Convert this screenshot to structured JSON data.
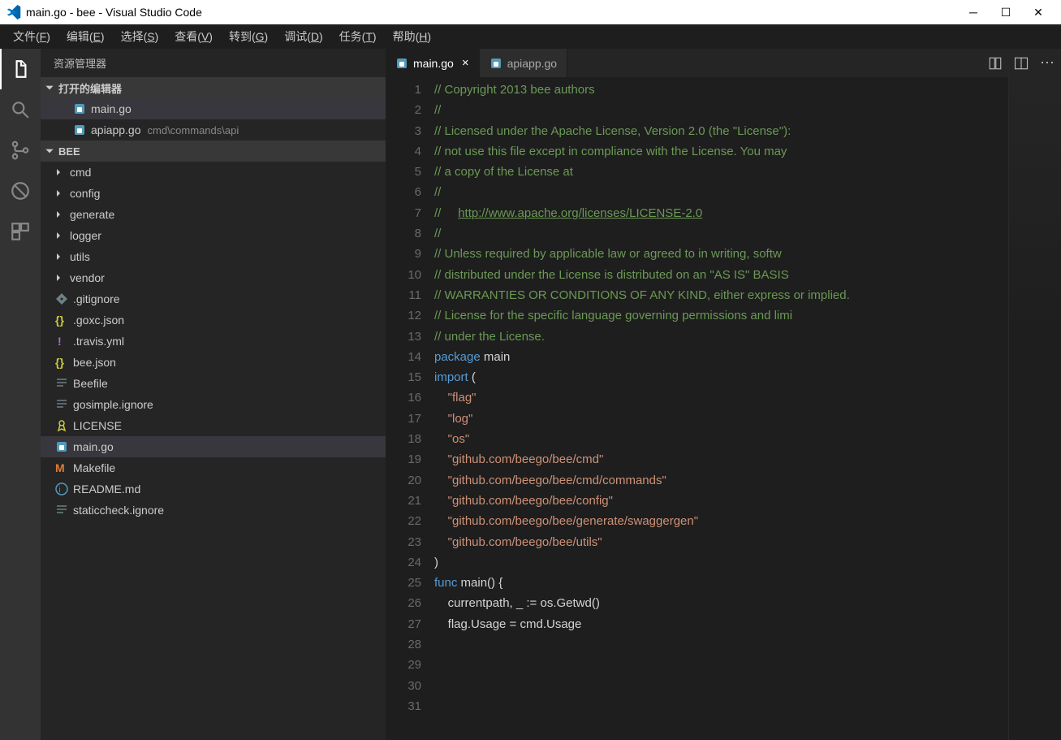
{
  "title": "main.go - bee - Visual Studio Code",
  "menubar": [
    "文件(F)",
    "编辑(E)",
    "选择(S)",
    "查看(V)",
    "转到(G)",
    "调试(D)",
    "任务(T)",
    "帮助(H)"
  ],
  "sidebar": {
    "title": "资源管理器",
    "openEditors": {
      "label": "打开的编辑器",
      "items": [
        {
          "name": "main.go",
          "path": "",
          "active": true,
          "icon": "go"
        },
        {
          "name": "apiapp.go",
          "path": "cmd\\commands\\api",
          "active": false,
          "icon": "go"
        }
      ]
    },
    "project": {
      "name": "BEE",
      "folders": [
        "cmd",
        "config",
        "generate",
        "logger",
        "utils",
        "vendor"
      ],
      "files": [
        {
          "name": ".gitignore",
          "icon": "git"
        },
        {
          "name": ".goxc.json",
          "icon": "json"
        },
        {
          "name": ".travis.yml",
          "icon": "yml"
        },
        {
          "name": "bee.json",
          "icon": "json"
        },
        {
          "name": "Beefile",
          "icon": "text"
        },
        {
          "name": "gosimple.ignore",
          "icon": "text"
        },
        {
          "name": "LICENSE",
          "icon": "license"
        },
        {
          "name": "main.go",
          "icon": "go",
          "active": true
        },
        {
          "name": "Makefile",
          "icon": "make"
        },
        {
          "name": "README.md",
          "icon": "md"
        },
        {
          "name": "staticcheck.ignore",
          "icon": "text"
        }
      ]
    }
  },
  "tabs": [
    {
      "name": "main.go",
      "active": true,
      "icon": "go",
      "close": true
    },
    {
      "name": "apiapp.go",
      "active": false,
      "icon": "go",
      "close": false
    }
  ],
  "code": [
    {
      "n": 1,
      "segs": [
        {
          "t": "// Copyright 2013 bee authors",
          "c": "comment"
        }
      ]
    },
    {
      "n": 2,
      "segs": [
        {
          "t": "//",
          "c": "comment"
        }
      ]
    },
    {
      "n": 3,
      "segs": [
        {
          "t": "// Licensed under the Apache License, Version 2.0 (the \"License\"): ",
          "c": "comment"
        }
      ]
    },
    {
      "n": 4,
      "segs": [
        {
          "t": "// not use this file except in compliance with the License. You may",
          "c": "comment"
        }
      ]
    },
    {
      "n": 5,
      "segs": [
        {
          "t": "// a copy of the License at",
          "c": "comment"
        }
      ]
    },
    {
      "n": 6,
      "segs": [
        {
          "t": "//",
          "c": "comment"
        }
      ]
    },
    {
      "n": 7,
      "segs": [
        {
          "t": "//     ",
          "c": "comment"
        },
        {
          "t": "http://www.apache.org/licenses/LICENSE-2.0",
          "c": "link"
        }
      ]
    },
    {
      "n": 8,
      "segs": [
        {
          "t": "//",
          "c": "comment"
        }
      ]
    },
    {
      "n": 9,
      "segs": [
        {
          "t": "// Unless required by applicable law or agreed to in writing, softw",
          "c": "comment"
        }
      ]
    },
    {
      "n": 10,
      "segs": [
        {
          "t": "// distributed under the License is distributed on an \"AS IS\" BASIS",
          "c": "comment"
        }
      ]
    },
    {
      "n": 11,
      "segs": [
        {
          "t": "// WARRANTIES OR CONDITIONS OF ANY KIND, either express or implied.",
          "c": "comment"
        }
      ]
    },
    {
      "n": 12,
      "segs": [
        {
          "t": "// License for the specific language governing permissions and limi",
          "c": "comment"
        }
      ]
    },
    {
      "n": 13,
      "segs": [
        {
          "t": "// under the License.",
          "c": "comment"
        }
      ]
    },
    {
      "n": 14,
      "segs": [
        {
          "t": "package",
          "c": "keyword"
        },
        {
          "t": " main",
          "c": "plain"
        }
      ]
    },
    {
      "n": 15,
      "segs": [
        {
          "t": "",
          "c": "plain"
        }
      ]
    },
    {
      "n": 16,
      "segs": [
        {
          "t": "import",
          "c": "keyword"
        },
        {
          "t": " (",
          "c": "plain"
        }
      ]
    },
    {
      "n": 17,
      "segs": [
        {
          "t": "    ",
          "c": "plain"
        },
        {
          "t": "\"flag\"",
          "c": "string"
        }
      ]
    },
    {
      "n": 18,
      "segs": [
        {
          "t": "    ",
          "c": "plain"
        },
        {
          "t": "\"log\"",
          "c": "string"
        }
      ]
    },
    {
      "n": 19,
      "segs": [
        {
          "t": "    ",
          "c": "plain"
        },
        {
          "t": "\"os\"",
          "c": "string"
        }
      ]
    },
    {
      "n": 20,
      "segs": [
        {
          "t": "",
          "c": "plain"
        }
      ]
    },
    {
      "n": 21,
      "segs": [
        {
          "t": "    ",
          "c": "plain"
        },
        {
          "t": "\"github.com/beego/bee/cmd\"",
          "c": "string"
        }
      ]
    },
    {
      "n": 22,
      "segs": [
        {
          "t": "    ",
          "c": "plain"
        },
        {
          "t": "\"github.com/beego/bee/cmd/commands\"",
          "c": "string"
        }
      ]
    },
    {
      "n": 23,
      "segs": [
        {
          "t": "    ",
          "c": "plain"
        },
        {
          "t": "\"github.com/beego/bee/config\"",
          "c": "string"
        }
      ]
    },
    {
      "n": 24,
      "segs": [
        {
          "t": "    ",
          "c": "plain"
        },
        {
          "t": "\"github.com/beego/bee/generate/swaggergen\"",
          "c": "string"
        }
      ]
    },
    {
      "n": 25,
      "segs": [
        {
          "t": "    ",
          "c": "plain"
        },
        {
          "t": "\"github.com/beego/bee/utils\"",
          "c": "string"
        }
      ]
    },
    {
      "n": 26,
      "segs": [
        {
          "t": ")",
          "c": "plain"
        }
      ]
    },
    {
      "n": 27,
      "segs": [
        {
          "t": "",
          "c": "plain"
        }
      ]
    },
    {
      "n": 28,
      "segs": [
        {
          "t": "func",
          "c": "keyword"
        },
        {
          "t": " main() {",
          "c": "plain"
        }
      ]
    },
    {
      "n": 29,
      "segs": [
        {
          "t": "    currentpath, _ := os.Getwd()",
          "c": "plain"
        }
      ]
    },
    {
      "n": 30,
      "segs": [
        {
          "t": "",
          "c": "plain"
        }
      ]
    },
    {
      "n": 31,
      "segs": [
        {
          "t": "    flag.Usage = cmd.Usage",
          "c": "plain"
        }
      ]
    }
  ]
}
